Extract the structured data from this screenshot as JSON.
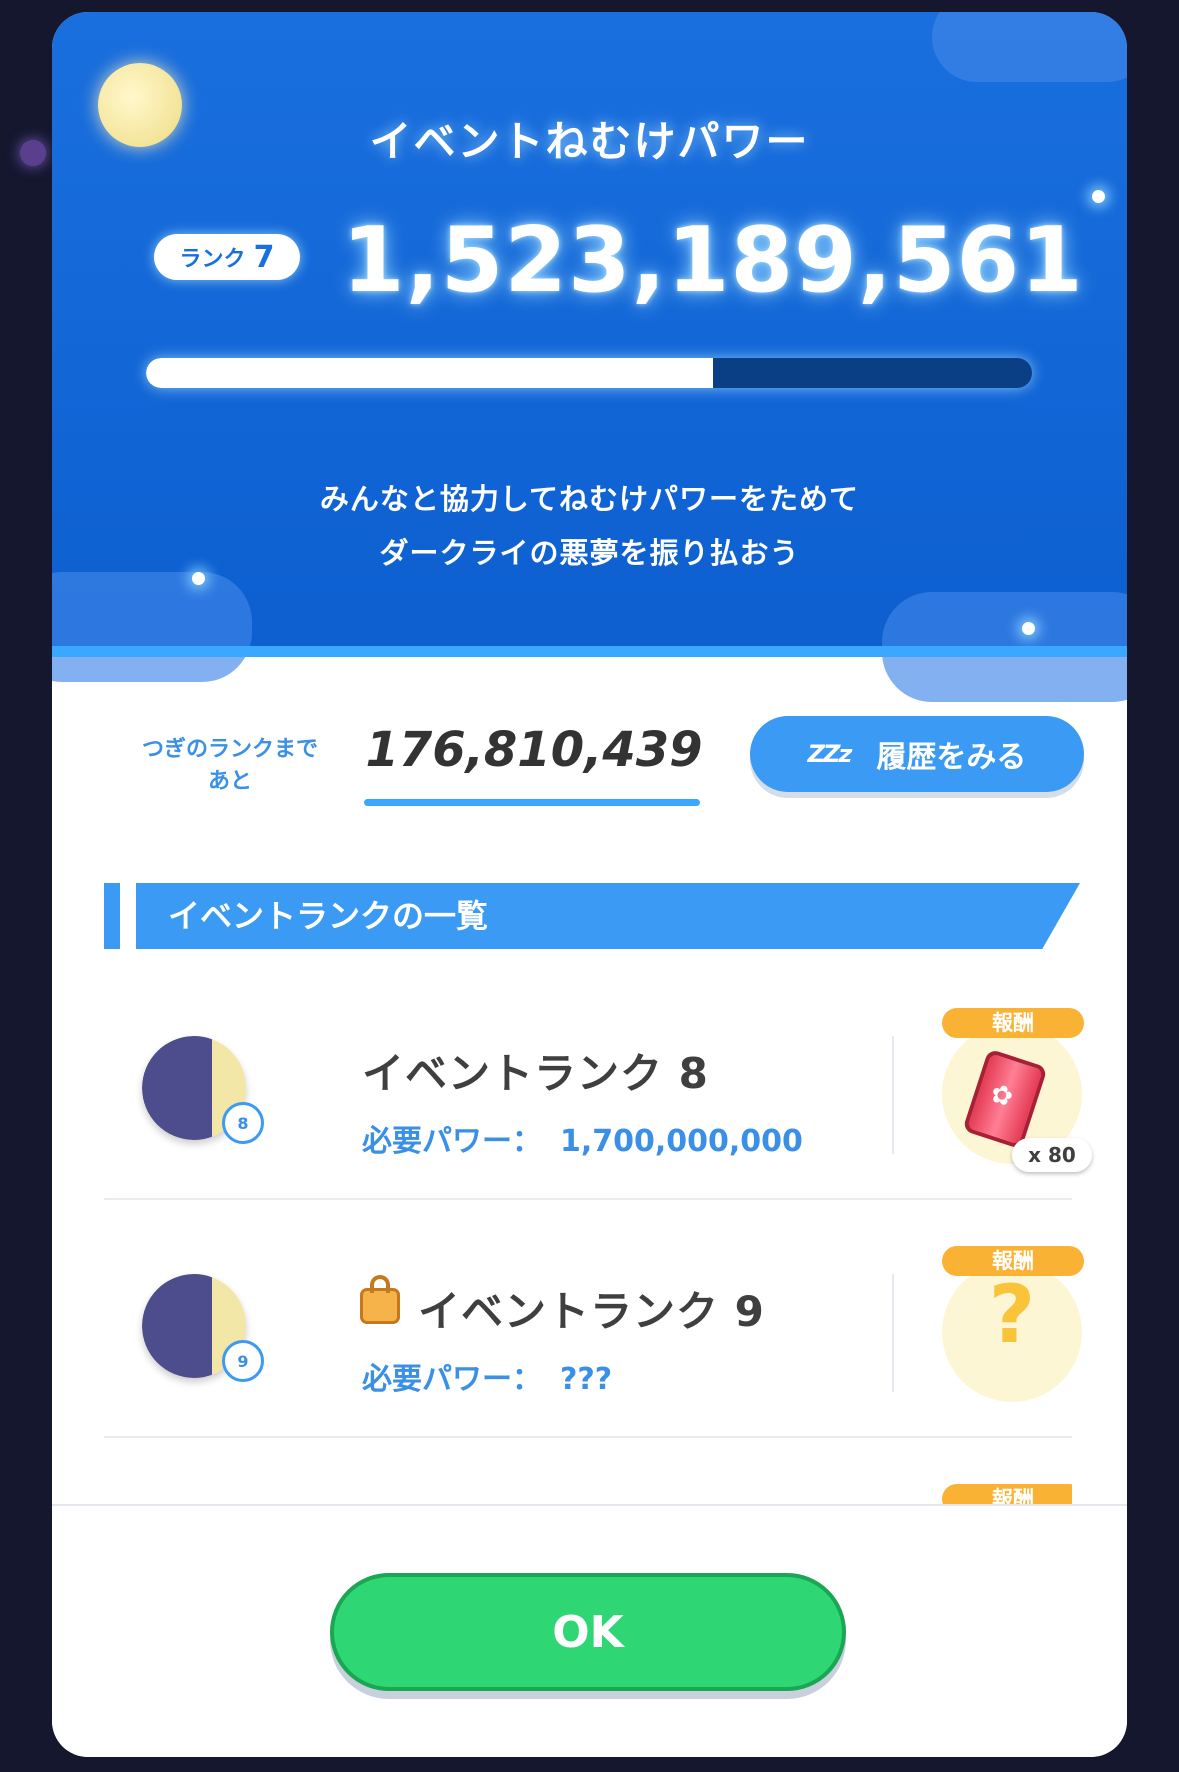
{
  "header": {
    "title": "イベントねむけパワー",
    "rank_label": "ランク",
    "rank_number": "7",
    "power_total": "1,523,189,561",
    "progress_fraction": 0.64,
    "description_line1": "みんなと協力してねむけパワーをためて",
    "description_line2": "ダークライの悪夢を振り払おう"
  },
  "next_rank": {
    "label_line1": "つぎのランクまで",
    "label_line2": "あと",
    "remaining": "176,810,439"
  },
  "history_button": {
    "icon": "zzz-icon",
    "icon_text": "ZZz",
    "label": "履歴をみる"
  },
  "section": {
    "title": "イベントランクの一覧"
  },
  "ranks": [
    {
      "name": "イベントランク 8",
      "badge": "8",
      "req_label": "必要パワー：",
      "req_value": "1,700,000,000",
      "locked": false,
      "reward_tag": "報酬",
      "reward_icon": "can-icon",
      "reward_qty": "x 80"
    },
    {
      "name": "イベントランク 9",
      "badge": "9",
      "req_label": "必要パワー：",
      "req_value": "???",
      "locked": true,
      "reward_tag": "報酬",
      "reward_icon": "question-icon",
      "reward_mystery": "?"
    },
    {
      "reward_tag": "報酬"
    }
  ],
  "footer": {
    "ok_label": "OK"
  },
  "colors": {
    "header_blue": "#0d5fd0",
    "accent_blue": "#3a9af4",
    "ok_green": "#2ed773",
    "reward_orange": "#f9b233"
  }
}
